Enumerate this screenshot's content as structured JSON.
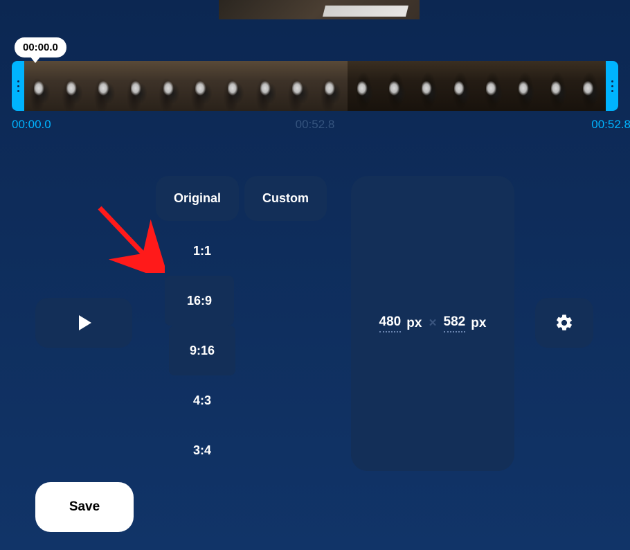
{
  "timeline": {
    "tooltip": "00:00.0",
    "start_label": "00:00.0",
    "mid_label": "00:52.8",
    "end_label": "00:52.8"
  },
  "aspect": {
    "tab_original": "Original",
    "tab_custom": "Custom",
    "ratios": [
      "1:1",
      "16:9",
      "9:16",
      "4:3",
      "3:4"
    ]
  },
  "dimensions": {
    "width": "480",
    "width_unit": "px",
    "sep": "×",
    "height": "582",
    "height_unit": "px"
  },
  "buttons": {
    "save": "Save"
  }
}
